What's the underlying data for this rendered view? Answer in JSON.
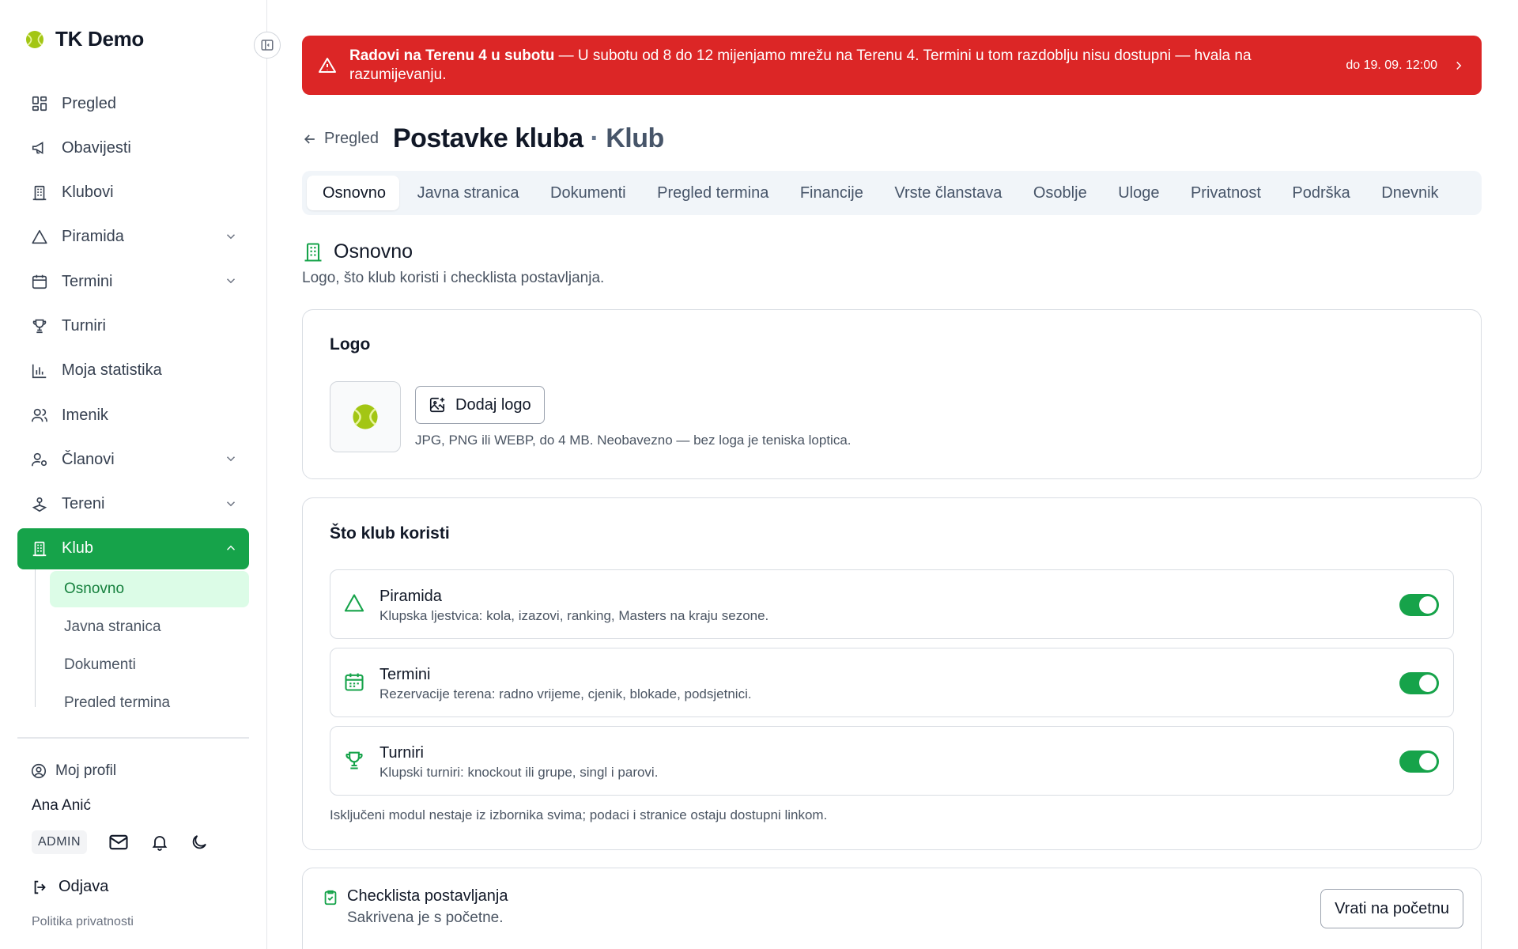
{
  "brand": {
    "name": "TK Demo"
  },
  "sidebar": {
    "items": [
      {
        "label": "Pregled",
        "icon": "dashboard-icon"
      },
      {
        "label": "Obavijesti",
        "icon": "megaphone-icon"
      },
      {
        "label": "Klubovi",
        "icon": "building-icon"
      },
      {
        "label": "Piramida",
        "icon": "triangle-icon",
        "expandable": true
      },
      {
        "label": "Termini",
        "icon": "calendar-icon",
        "expandable": true
      },
      {
        "label": "Turniri",
        "icon": "trophy-icon"
      },
      {
        "label": "Moja statistika",
        "icon": "bar-chart-icon"
      },
      {
        "label": "Imenik",
        "icon": "users-icon"
      },
      {
        "label": "Članovi",
        "icon": "user-settings-icon",
        "expandable": true
      },
      {
        "label": "Tereni",
        "icon": "court-icon",
        "expandable": true
      },
      {
        "label": "Klub",
        "icon": "building-icon",
        "expanded": true,
        "active": true
      }
    ],
    "subitems": [
      {
        "label": "Osnovno",
        "active": true
      },
      {
        "label": "Javna stranica"
      },
      {
        "label": "Dokumenti"
      },
      {
        "label": "Pregled termina"
      }
    ],
    "profile_label": "Moj profil",
    "user_name": "Ana Anić",
    "role": "ADMIN",
    "logout_label": "Odjava",
    "privacy_label": "Politika privatnosti"
  },
  "banner": {
    "title": "Radovi na Terenu 4 u subotu",
    "message": " — U subotu od 8 do 12 mijenjamo mrežu na Terenu 4. Termini u tom razdoblju nisu dostupni — hvala na razumijevanju.",
    "date": "do 19. 09. 12:00",
    "color": "#dc2626"
  },
  "header": {
    "back_label": "Pregled",
    "title": "Postavke kluba",
    "separator": "·",
    "subtitle": "Klub"
  },
  "tabs": [
    {
      "label": "Osnovno",
      "active": true
    },
    {
      "label": "Javna stranica"
    },
    {
      "label": "Dokumenti"
    },
    {
      "label": "Pregled termina"
    },
    {
      "label": "Financije"
    },
    {
      "label": "Vrste članstava"
    },
    {
      "label": "Osoblje"
    },
    {
      "label": "Uloge"
    },
    {
      "label": "Privatnost"
    },
    {
      "label": "Podrška"
    },
    {
      "label": "Dnevnik"
    }
  ],
  "section": {
    "title": "Osnovno",
    "description": "Logo, što klub koristi i checklista postavljanja."
  },
  "logo_card": {
    "title": "Logo",
    "button_label": "Dodaj logo",
    "hint": "JPG, PNG ili WEBP, do 4 MB. Neobavezno — bez loga je teniska loptica."
  },
  "modules_card": {
    "title": "Što klub koristi",
    "modules": [
      {
        "title": "Piramida",
        "description": "Klupska ljestvica: kola, izazovi, ranking, Masters na kraju sezone.",
        "icon": "triangle-icon",
        "enabled": true
      },
      {
        "title": "Termini",
        "description": "Rezervacije terena: radno vrijeme, cjenik, blokade, podsjetnici.",
        "icon": "calendar-icon",
        "enabled": true
      },
      {
        "title": "Turniri",
        "description": "Klupski turniri: knockout ili grupe, singl i parovi.",
        "icon": "trophy-icon",
        "enabled": true
      }
    ],
    "note": "Isključeni modul nestaje iz izbornika svima; podaci i stranice ostaju dostupni linkom."
  },
  "checklist_card": {
    "title": "Checklista postavljanja",
    "description": "Sakrivena je s početne.",
    "button_label": "Vrati na početnu"
  },
  "colors": {
    "accent": "#16a34a",
    "accent_light": "#dcfce7",
    "danger": "#dc2626"
  }
}
